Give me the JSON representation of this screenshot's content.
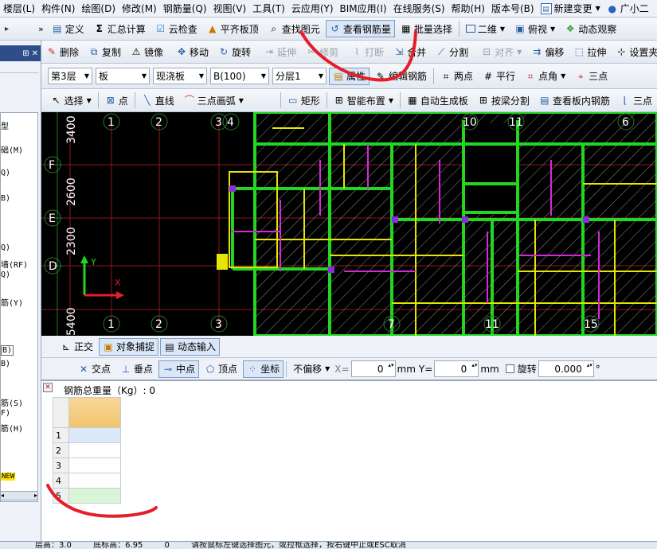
{
  "menus": [
    "楼层(L)",
    "构件(N)",
    "绘图(D)",
    "修改(M)",
    "钢筋量(Q)",
    "视图(V)",
    "工具(T)",
    "云应用(Y)",
    "BIM应用(I)",
    "在线服务(S)",
    "帮助(H)",
    "版本号(B)"
  ],
  "menu_new_change": "新建变更",
  "menu_user": "广小二",
  "toolbar1": [
    "定义",
    "汇总计算",
    "云检查",
    "平齐板顶",
    "查找图元",
    "查看钢筋量",
    "批量选择"
  ],
  "view_2d": "二维",
  "view_top": "俯视",
  "view_dynamic": "动态观察",
  "toolbar2": [
    "删除",
    "复制",
    "镜像",
    "移动",
    "旋转",
    "延伸",
    "修剪",
    "打断",
    "合并",
    "分割",
    "对齐",
    "偏移",
    "拉伸",
    "设置夹"
  ],
  "combos": {
    "floor": "第3层",
    "type": "板",
    "subtype": "现浇板",
    "member": "B(100)",
    "layer": "分层1"
  },
  "tb3_buttons": [
    "属性",
    "编辑钢筋",
    "两点",
    "平行",
    "点角",
    "三点"
  ],
  "toolbar4": [
    "选择",
    "点",
    "直线",
    "三点画弧",
    "矩形",
    "智能布置",
    "自动生成板",
    "按梁分割",
    "查看板内钢筋",
    "三点"
  ],
  "left_panel": {
    "items": [
      "型",
      "础(M)",
      "Q)",
      "B)",
      "Q)",
      "墙(RF)",
      "Q)",
      "筋(Y)",
      "B)",
      "B)",
      "筋(S)",
      "F)",
      "筋(H)"
    ],
    "new_badge": "NEW"
  },
  "canvas": {
    "axis_top": [
      "1",
      "2",
      "3",
      "4",
      "10",
      "11",
      "6"
    ],
    "axis_bottom": [
      "1",
      "2",
      "3",
      "7",
      "11",
      "15"
    ],
    "axis_left": [
      "F",
      "E",
      "D"
    ],
    "dims": [
      "3400",
      "2600",
      "2300",
      "5400"
    ],
    "ucs_y": "Y",
    "ucs_x": "X"
  },
  "snap_bar": [
    "正交",
    "对象捕捉",
    "动态输入"
  ],
  "snap_bar2": [
    "交点",
    "垂点",
    "中点",
    "顶点",
    "坐标"
  ],
  "offset_mode": "不偏移",
  "x_label": "X=",
  "x_value": "0",
  "y_label": "Y=",
  "y_value": "0",
  "unit": "mm",
  "rotate_label": "旋转",
  "rotate_value": "0.000",
  "degree": "°",
  "rebar_panel": {
    "title": "钢筋总重量（Kg）: 0",
    "rows": [
      "1",
      "2",
      "3",
      "4",
      "5"
    ]
  },
  "status": {
    "floor_height": "层高：3.0",
    "bottom_elev": "底标高：6.95",
    "zero": "0",
    "hint": "请按鼠标左键选择图元，或拉框选择，按右键中止或ESC取消"
  },
  "colors": {
    "canvas_bg": "#000000",
    "wall_green": "#22d622",
    "beam_yellow": "#e6e600",
    "rebar_magenta": "#d62ad6",
    "annot_red": "#e41e2a"
  }
}
